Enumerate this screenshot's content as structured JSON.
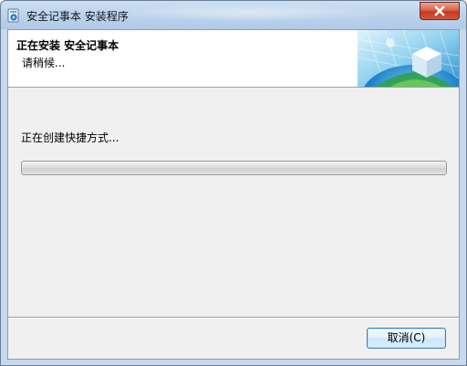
{
  "window": {
    "title": "安全记事本 安装程序",
    "close_label": "X"
  },
  "header": {
    "title": "正在安装 安全记事本",
    "subtitle": "请稍候..."
  },
  "main": {
    "status": "正在创建快捷方式...",
    "progress_percent": 0
  },
  "footer": {
    "cancel_label": "取消(C)"
  },
  "icons": {
    "app": "installer-icon",
    "header_art": "globe-cube-icon",
    "close": "close-icon"
  },
  "colors": {
    "titlebar": "#bcd3ec",
    "close_button": "#c23a22",
    "client_bg": "#f0f0f0",
    "button_border": "#3c7fb1"
  }
}
